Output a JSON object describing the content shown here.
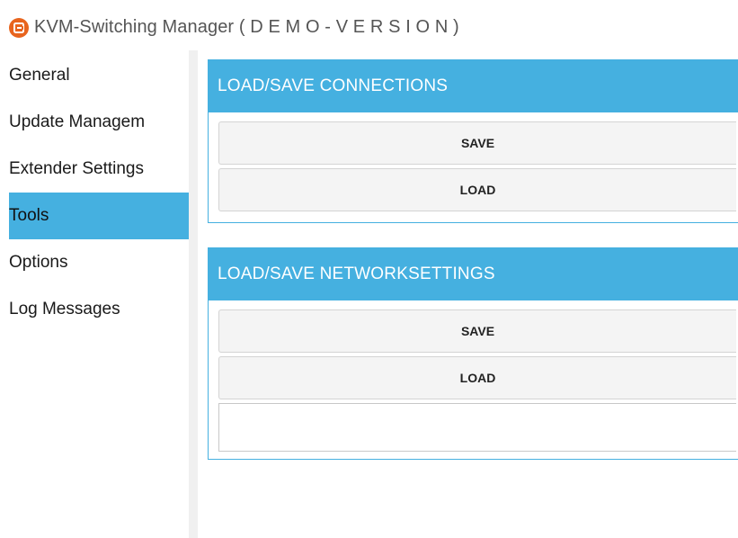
{
  "window": {
    "title": "KVM-Switching Manager ( D E M O - V E R S I O N )",
    "logo_icon": "app-logo-icon",
    "accent_color": "#45b0e0",
    "logo_color": "#e8641e"
  },
  "sidebar": {
    "items": [
      {
        "label": "General",
        "active": false
      },
      {
        "label": "Update Managem",
        "active": false
      },
      {
        "label": "Extender Settings",
        "active": false
      },
      {
        "label": "Tools",
        "active": true
      },
      {
        "label": "Options",
        "active": false
      },
      {
        "label": "Log Messages",
        "active": false
      }
    ]
  },
  "panels": {
    "connections": {
      "title": "LOAD/SAVE CONNECTIONS",
      "save_label": "SAVE",
      "load_label": "LOAD"
    },
    "networksettings": {
      "title": "LOAD/SAVE NETWORKSETTINGS",
      "save_label": "SAVE",
      "load_label": "LOAD",
      "field_value": ""
    }
  }
}
